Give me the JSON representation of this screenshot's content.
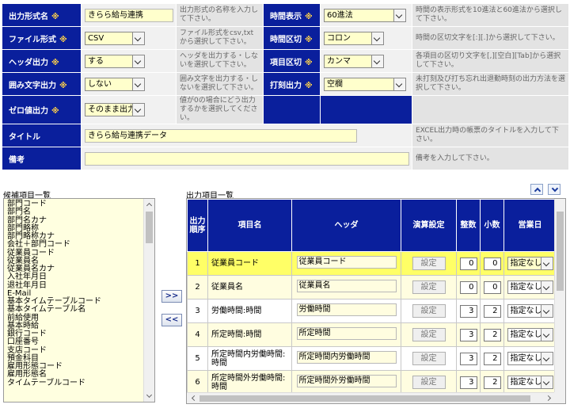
{
  "form": {
    "rows": [
      {
        "label": "出力形式名",
        "required": true,
        "value": "きらら給与連携",
        "desc": "出力形式の名称を入力して下さい。",
        "label2": "時間表示",
        "required2": true,
        "value2": "60進法",
        "desc2": "時間の表示形式を10進法と60進法から選択して下さい。"
      },
      {
        "label": "ファイル形式",
        "required": true,
        "value": "CSV",
        "desc": "ファイル形式をcsv,txtから選択して下さい。",
        "label2": "時間区切",
        "required2": true,
        "value2": "コロン",
        "desc2": "時間の区切文字を[:][.]から選択して下さい。"
      },
      {
        "label": "ヘッダ出力",
        "required": true,
        "value": "する",
        "desc": "ヘッダを出力する・しないを選択して下さい。",
        "label2": "項目区切",
        "required2": true,
        "value2": "カンマ",
        "desc2": "各項目の区切り文字を[,][空白][Tab]から選択して下さい。"
      },
      {
        "label": "囲み文字出力",
        "required": true,
        "value": "しない",
        "desc": "囲み文字を出力する・しないを選択して下さい。",
        "label2": "打刻出力",
        "required2": true,
        "value2": "空欄",
        "desc2": "未打刻及び打ち忘れ出退勤時刻の出力方法を選択して下さい。"
      },
      {
        "label": "ゼロ値出力",
        "required": true,
        "value": "そのまま出力",
        "desc": "値が0の場合にどう出力するかを選択してください。"
      }
    ],
    "title_label": "タイトル",
    "title_value": "きらら給与連携データ",
    "title_desc": "EXCEL出力時の帳票のタイトルを入力して下さい。",
    "memo_label": "備考",
    "memo_value": "",
    "memo_desc": "備考を入力して下さい。",
    "required_mark": "※"
  },
  "candidates": {
    "title": "候補項目一覧",
    "items": [
      "部門コード",
      "部門名",
      "部門名カナ",
      "部門略称",
      "部門略称カナ",
      "会社＋部門コード",
      "従業員コード",
      "従業員名",
      "従業員名カナ",
      "入社年月日",
      "退社年月日",
      "E-Mail",
      "基本タイムテーブルコード",
      "基本タイムテーブル名",
      "前給使用",
      "基本時給",
      "銀行コード",
      "口座番号",
      "支店コード",
      "預金科目",
      "雇用形態コード",
      "雇用形態名",
      "タイムテーブルコード"
    ]
  },
  "move": {
    "add_label": ">>",
    "remove_label": "<<"
  },
  "output": {
    "title": "出力項目一覧",
    "headers": {
      "order": "出力順序",
      "name": "項目名",
      "header": "ヘッダ",
      "calc": "演算設定",
      "int": "整数",
      "dec": "小数",
      "bizday": "営業日"
    },
    "set_label": "設定",
    "rows": [
      {
        "no": "1",
        "name": "従業員コード",
        "header": "従業員コード",
        "int": "0",
        "dec": "0",
        "bizday": "指定なし"
      },
      {
        "no": "2",
        "name": "従業員名",
        "header": "従業員名",
        "int": "0",
        "dec": "0",
        "bizday": "指定なし"
      },
      {
        "no": "3",
        "name": "労働時間:時間",
        "header": "労働時間",
        "int": "3",
        "dec": "2",
        "bizday": "指定なし"
      },
      {
        "no": "4",
        "name": "所定時間:時間",
        "header": "所定時間",
        "int": "3",
        "dec": "2",
        "bizday": "指定なし"
      },
      {
        "no": "5",
        "name": "所定時間内労働時間:時間",
        "header": "所定時間内労働時間",
        "int": "3",
        "dec": "2",
        "bizday": "指定なし"
      },
      {
        "no": "6",
        "name": "所定時間外労働時間:時間",
        "header": "所定時間外労働時間",
        "int": "3",
        "dec": "2",
        "bizday": "指定なし"
      }
    ]
  }
}
